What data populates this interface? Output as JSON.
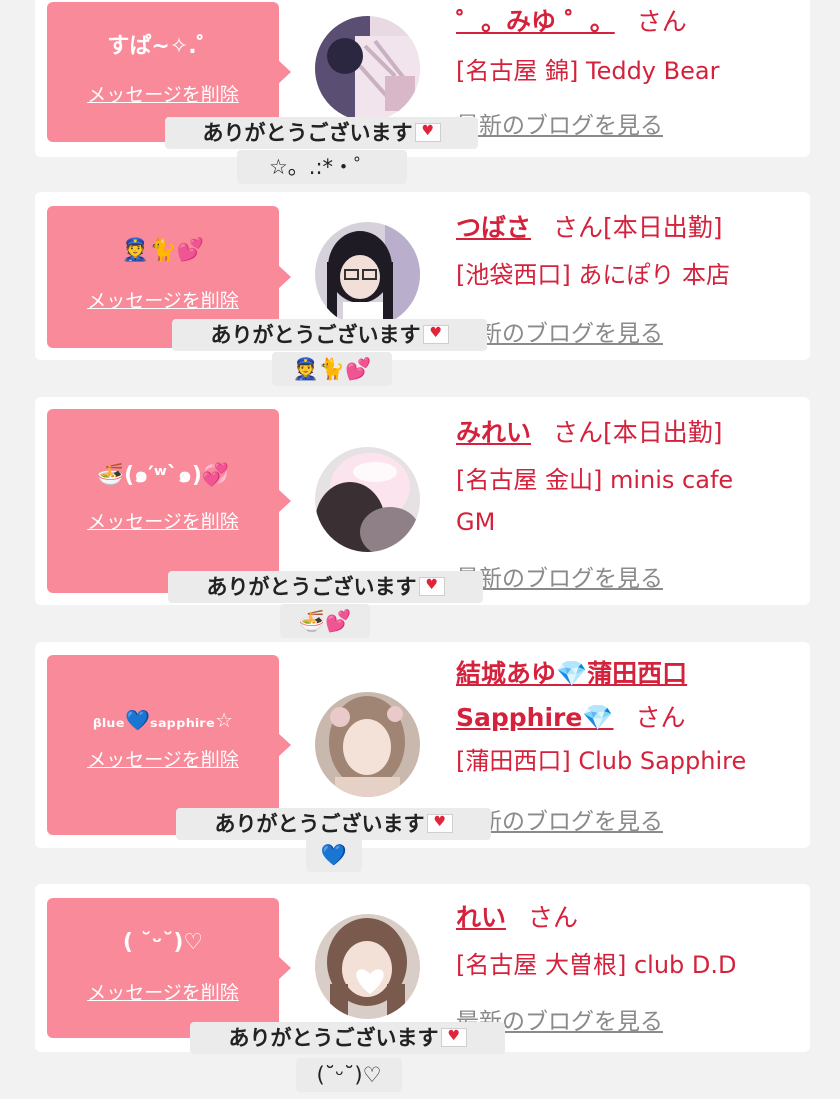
{
  "common": {
    "delete_label": "メッセージを削除",
    "blog_label": "最新のブログを見る",
    "thanks_text": "ありがとうございます",
    "san": "さん",
    "envelope_icon": "love-letter-icon"
  },
  "colors": {
    "bubble": "#f98a99",
    "accent": "#d4223c",
    "page_bg": "#f2f2f2",
    "link_gray": "#8a8a8a"
  },
  "cards": [
    {
      "message": "すぱ~✧.゜",
      "name": "゜。みゆ ゜。",
      "status": "",
      "shop": "[名古屋 錦] Teddy Bear",
      "thanks_suffix": "☆。.:*・゜"
    },
    {
      "message": "👮🐈💕",
      "name": "つばさ",
      "status": "[本日出勤]",
      "shop": "[池袋西口] あにぽり 本店",
      "thanks_suffix": "👮🐈💕"
    },
    {
      "message": "🍜(๑′ʷ`๑)💞",
      "name": "みれい",
      "status": "[本日出勤]",
      "shop": "[名古屋 金山] minis cafe GM",
      "thanks_suffix": "🍜💕"
    },
    {
      "message": "ᵦₗᵤₑ💙ₛₐₚₚₕᵢᵣₑ☆",
      "name_line1": "結城あゆ💎蒲田西口",
      "name_line2": "Sapphire💎",
      "status": "",
      "shop": "[蒲田西口] Club Sapphire",
      "thanks_suffix": "💙"
    },
    {
      "message": "( ˘ᵕ˘)♡",
      "name": "れい",
      "status": "",
      "shop": "[名古屋 大曽根] club D.D",
      "thanks_suffix": "(˘ᵕ˘)♡"
    }
  ]
}
